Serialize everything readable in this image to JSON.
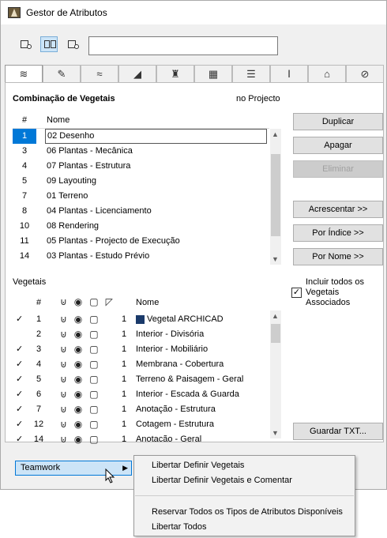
{
  "window": {
    "title": "Gestor de Atributos"
  },
  "search": {
    "value": ""
  },
  "section1": {
    "title": "Combinação de Vegetais",
    "scope": "no Projecto",
    "col_num": "#",
    "col_name": "Nome",
    "rows": [
      {
        "num": "1",
        "name": "02 Desenho"
      },
      {
        "num": "3",
        "name": "06 Plantas - Mecânica"
      },
      {
        "num": "4",
        "name": "07 Plantas - Estrutura"
      },
      {
        "num": "5",
        "name": "09 Layouting"
      },
      {
        "num": "7",
        "name": "01 Terreno"
      },
      {
        "num": "8",
        "name": "04 Plantas - Licenciamento"
      },
      {
        "num": "10",
        "name": "08 Rendering"
      },
      {
        "num": "11",
        "name": "05 Plantas - Projecto de Execução"
      },
      {
        "num": "14",
        "name": "03 Plantas - Estudo Prévio"
      }
    ]
  },
  "buttons": {
    "duplicar": "Duplicar",
    "apagar": "Apagar",
    "eliminar": "Eliminar",
    "acrescentar": "Acrescentar >>",
    "por_indice": "Por Índice >>",
    "por_nome": "Por Nome >>",
    "guardar_txt": "Guardar TXT..."
  },
  "section2": {
    "title": "Vegetais",
    "col_num": "#",
    "col_name": "Nome",
    "include_label_1": "Incluir todos os",
    "include_label_2": "Vegetais",
    "include_label_3": "Associados",
    "include_checked": "✓",
    "rows": [
      {
        "check": "✓",
        "num": "1",
        "val": "1",
        "name": "Vegetal ARCHICAD"
      },
      {
        "check": "",
        "num": "2",
        "val": "1",
        "name": "Interior - Divisória"
      },
      {
        "check": "✓",
        "num": "3",
        "val": "1",
        "name": "Interior - Mobiliário"
      },
      {
        "check": "✓",
        "num": "4",
        "val": "1",
        "name": "Membrana - Cobertura"
      },
      {
        "check": "✓",
        "num": "5",
        "val": "1",
        "name": "Terreno & Paisagem - Geral"
      },
      {
        "check": "✓",
        "num": "6",
        "val": "1",
        "name": "Interior - Escada & Guarda"
      },
      {
        "check": "✓",
        "num": "7",
        "val": "1",
        "name": "Anotação - Estrutura"
      },
      {
        "check": "✓",
        "num": "12",
        "val": "1",
        "name": "Cotagem - Estrutura"
      },
      {
        "check": "✓",
        "num": "14",
        "val": "1",
        "name": "Anotacão - Geral"
      }
    ]
  },
  "teamwork": {
    "label": "Teamwork"
  },
  "menu": {
    "item1": "Libertar Definir Vegetais",
    "item2": "Libertar Definir Vegetais e Comentar",
    "item3": "Reservar Todos os Tipos de Atributos Disponíveis",
    "item4": "Libertar Todos"
  },
  "colors": {
    "selection": "#0078d7",
    "tab_active": "#ffffff"
  }
}
